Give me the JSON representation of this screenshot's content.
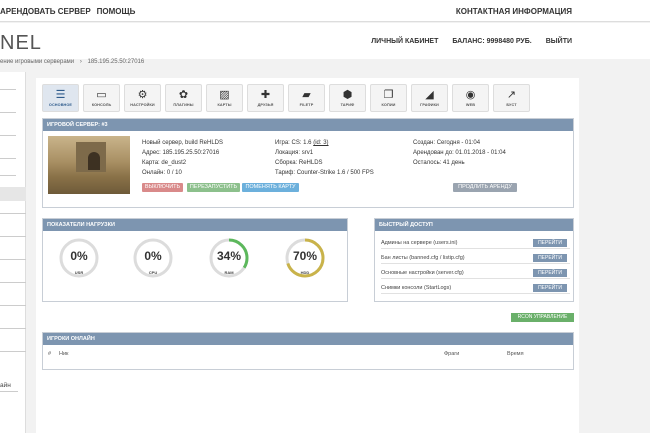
{
  "topbar": {
    "nav": [
      "?",
      "АРЕНДОВАТЬ СЕРВЕР",
      "ПОМОЩЬ"
    ],
    "contact": "КОНТАКТНАЯ ИНФОРМАЦИЯ"
  },
  "header": {
    "logo": "NEL",
    "cabinet": "ЛИЧНЫЙ КАБИНЕТ",
    "balance": "БАЛАНС: 9998480 РУБ.",
    "logout": "ВЫЙТИ"
  },
  "breadcrumb": {
    "first": "ение игровыми серверами",
    "sep": "›",
    "last": "185.195.25.50:27016"
  },
  "sidebar": {
    "footer": "айн"
  },
  "toolbar": [
    {
      "label": "ОСНОВНОЕ",
      "icon": "menu-icon",
      "glyph": "☰",
      "active": true
    },
    {
      "label": "КОНСОЛЬ",
      "icon": "console-icon",
      "glyph": "▭",
      "active": false
    },
    {
      "label": "НАСТРОЙКИ",
      "icon": "settings-icon",
      "glyph": "⚙",
      "active": false
    },
    {
      "label": "ПЛАГИНЫ",
      "icon": "plugins-icon",
      "glyph": "✿",
      "active": false
    },
    {
      "label": "КАРТЫ",
      "icon": "image-icon",
      "glyph": "▨",
      "active": false
    },
    {
      "label": "ДРУЗЬЯ",
      "icon": "add-user-icon",
      "glyph": "✚",
      "active": false
    },
    {
      "label": "FILETP",
      "icon": "folder-icon",
      "glyph": "▰",
      "active": false
    },
    {
      "label": "ТАРИФ",
      "icon": "tariff-icon",
      "glyph": "⬢",
      "active": false
    },
    {
      "label": "КОПИИ",
      "icon": "copy-icon",
      "glyph": "❐",
      "active": false
    },
    {
      "label": "ГРАФИКИ",
      "icon": "area-chart-icon",
      "glyph": "◢",
      "active": false
    },
    {
      "label": "WEB",
      "icon": "globe-icon",
      "glyph": "◉",
      "active": false
    },
    {
      "label": "БУСТ",
      "icon": "line-chart-icon",
      "glyph": "↗",
      "active": false
    }
  ],
  "server": {
    "title": "ИГРОВОЙ СЕРВЕР: #3",
    "name": "Новый сервер, build ReHLDS",
    "address": "Адрес: 185.195.25.50:27016",
    "map": "Карта: de_dust2",
    "online": "Онлайн: 0 / 10",
    "game": "Игра: CS: 1.6",
    "game_link": "(id: 3)",
    "location": "Локация: srv1",
    "build": "Сборка: ReHLDS",
    "tariff": "Тариф: Counter-Strike 1.6 / 500 FPS",
    "created": "Создан: Сегодня - 01:04",
    "rented_until": "Арендован до: 01.01.2018 - 01:04",
    "left": "Осталось: 41 день",
    "btn_off": "ВЫКЛЮЧИТЬ",
    "btn_restart": "ПЕРЕЗАПУСТИТЬ",
    "btn_map": "ПОМЕНЯТЬ КАРТУ",
    "btn_extend": "ПРОДЛИТЬ АРЕНДУ",
    "colors": {
      "off": "#d98a8a",
      "restart": "#8cc08c",
      "map": "#6cb0dc",
      "extend": "#9aa4b0"
    }
  },
  "load": {
    "title": "ПОКАЗАТЕЛИ НАГРУЗКИ",
    "gauges": [
      {
        "label": "USR",
        "value": "0%",
        "level": 0
      },
      {
        "label": "CPU",
        "value": "0%",
        "level": 0
      },
      {
        "label": "RAM",
        "value": "34%",
        "level": 0.34
      },
      {
        "label": "HDD",
        "value": "70%",
        "level": 0.7
      }
    ],
    "colors": {
      "track": "#dcdcdc",
      "ram": "#5cb85c",
      "hdd": "#c9b34a"
    }
  },
  "quick": {
    "title": "БЫСТРЫЙ ДОСТУП",
    "items": [
      {
        "label": "Админы на сервере (users.ini)",
        "button": "ПЕРЕЙТИ"
      },
      {
        "label": "Бан листы (banned.cfg / listip.cfg)",
        "button": "ПЕРЕЙТИ"
      },
      {
        "label": "Основные настройки (server.cfg)",
        "button": "ПЕРЕЙТИ"
      },
      {
        "label": "Снимки консоли (StartLogs)",
        "button": "ПЕРЕЙТИ"
      }
    ]
  },
  "rcon": "RCON УПРАВЛЕНИЕ",
  "players": {
    "title": "ИГРОКИ ОНЛАЙН",
    "columns": [
      "#",
      "Ник",
      "Фраги",
      "Время"
    ]
  }
}
